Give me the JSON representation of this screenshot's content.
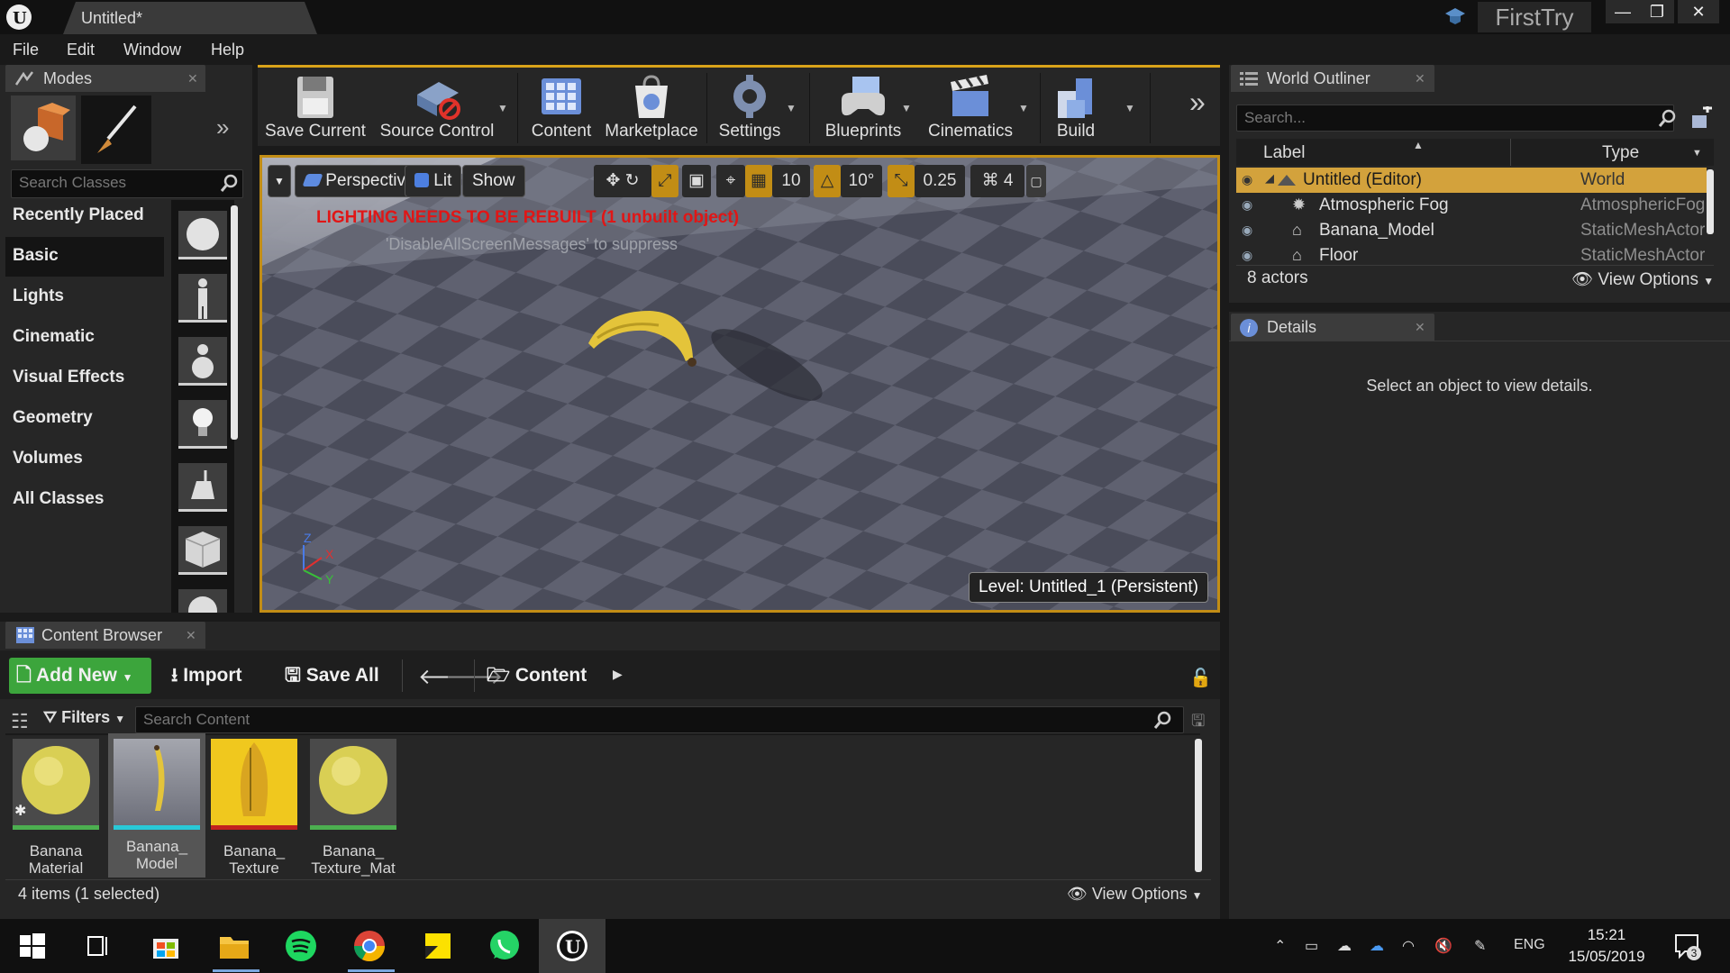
{
  "window": {
    "doc_tab": "Untitled*",
    "project": "FirstTry",
    "minimize": "—",
    "restore": "❐",
    "close": "✕"
  },
  "menu": [
    "File",
    "Edit",
    "Window",
    "Help"
  ],
  "modes": {
    "title": "Modes",
    "search_placeholder": "Search Classes",
    "categories": [
      "Recently Placed",
      "Basic",
      "Lights",
      "Cinematic",
      "Visual Effects",
      "Geometry",
      "Volumes",
      "All Classes"
    ],
    "selected_category": "Basic"
  },
  "toolbar": {
    "save_current": "Save Current",
    "source_control": "Source Control",
    "content": "Content",
    "marketplace": "Marketplace",
    "settings": "Settings",
    "blueprints": "Blueprints",
    "cinematics": "Cinematics",
    "build": "Build"
  },
  "viewport": {
    "perspective": "Perspective",
    "lit": "Lit",
    "show": "Show",
    "grid_snap": "10",
    "rotation_snap": "10°",
    "scale_snap": "0.25",
    "camera_speed": "4",
    "lighting_warning": "LIGHTING NEEDS TO BE REBUILT (1 unbuilt object)",
    "suppress_message": "'DisableAllScreenMessages' to suppress",
    "level": "Level:  Untitled_1 (Persistent)",
    "axis_x": "X",
    "axis_y": "Y",
    "axis_z": "Z"
  },
  "outliner": {
    "title": "World Outliner",
    "search_placeholder": "Search...",
    "col_label": "Label",
    "col_type": "Type",
    "rows": [
      {
        "label": "Untitled (Editor)",
        "type": "World"
      },
      {
        "label": "Atmospheric Fog",
        "type": "AtmosphericFog"
      },
      {
        "label": "Banana_Model",
        "type": "StaticMeshActor"
      },
      {
        "label": "Floor",
        "type": "StaticMeshActor"
      }
    ],
    "actor_count": "8 actors",
    "view_options": "View Options"
  },
  "details": {
    "title": "Details",
    "empty_message": "Select an object to view details."
  },
  "content_browser": {
    "title": "Content Browser",
    "add_new": "Add New",
    "import": "Import",
    "save_all": "Save All",
    "path": "Content",
    "filters": "Filters",
    "search_placeholder": "Search Content",
    "assets": [
      {
        "line1": "Banana",
        "line2": "Material",
        "color": "#4caf50"
      },
      {
        "line1": "Banana_",
        "line2": "Model",
        "color": "#29c9d8"
      },
      {
        "line1": "Banana_",
        "line2": "Texture",
        "color": "#c2221f"
      },
      {
        "line1": "Banana_",
        "line2": "Texture_Mat",
        "color": "#4caf50"
      }
    ],
    "status": "4 items (1 selected)",
    "view_options": "View Options"
  },
  "taskbar": {
    "language": "ENG",
    "time": "15:21",
    "date": "15/05/2019",
    "notifications": "3"
  }
}
